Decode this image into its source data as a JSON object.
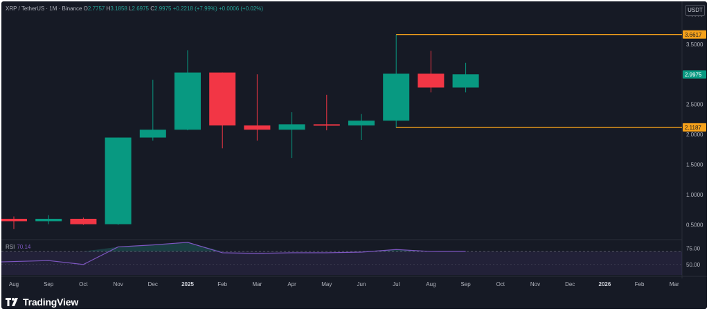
{
  "header": {
    "symbol": "XRP / TetherUS · 1M · Binance",
    "open_key": "O",
    "open": "2.7757",
    "high_key": "H",
    "high": "3.1858",
    "low_key": "L",
    "low": "2.6975",
    "close_key": "C",
    "close": "2.9975",
    "change": "+0.2218 (+7.99%)",
    "change2": "+0.0006 (+0.02%)"
  },
  "currency_button": "USDT",
  "brand": "TradingView",
  "colors": {
    "up": "#089981",
    "down": "#f23645",
    "level": "#f7a21b",
    "rsi": "#7e57c2",
    "background": "#161a25"
  },
  "chart_data": {
    "type": "candlestick",
    "interval": "1M",
    "x_tick_labels": [
      "Aug",
      "Sep",
      "Oct",
      "Nov",
      "Dec",
      "2025",
      "Feb",
      "Mar",
      "Apr",
      "May",
      "Jun",
      "Jul",
      "Aug",
      "Sep",
      "Oct",
      "Nov",
      "Dec",
      "2026",
      "Feb",
      "Mar"
    ],
    "y_ticks": [
      "0.5000",
      "1.0000",
      "1.5000",
      "2.0000",
      "2.5000",
      "3.0000",
      "3.5000",
      "4.0000"
    ],
    "y_tick_values": [
      0.5,
      1.0,
      1.5,
      2.0,
      2.5,
      3.0,
      3.5,
      4.0
    ],
    "ylim": [
      0.3,
      4.05
    ],
    "candles": [
      {
        "month": "Aug",
        "o": 0.6,
        "h": 0.64,
        "l": 0.43,
        "c": 0.56
      },
      {
        "month": "Sep",
        "o": 0.56,
        "h": 0.66,
        "l": 0.51,
        "c": 0.6
      },
      {
        "month": "Oct",
        "o": 0.6,
        "h": 0.62,
        "l": 0.5,
        "c": 0.51
      },
      {
        "month": "Nov",
        "o": 0.51,
        "h": 1.95,
        "l": 0.5,
        "c": 1.95
      },
      {
        "month": "Dec",
        "o": 1.95,
        "h": 2.91,
        "l": 1.9,
        "c": 2.08
      },
      {
        "month": "2025",
        "o": 2.08,
        "h": 3.4,
        "l": 2.07,
        "c": 3.03
      },
      {
        "month": "Feb",
        "o": 3.03,
        "h": 3.03,
        "l": 1.77,
        "c": 2.15
      },
      {
        "month": "Mar",
        "o": 2.15,
        "h": 3.0,
        "l": 1.9,
        "c": 2.08
      },
      {
        "month": "Apr",
        "o": 2.08,
        "h": 2.37,
        "l": 1.61,
        "c": 2.17
      },
      {
        "month": "May",
        "o": 2.17,
        "h": 2.66,
        "l": 2.07,
        "c": 2.15
      },
      {
        "month": "Jun",
        "o": 2.15,
        "h": 2.34,
        "l": 1.91,
        "c": 2.23
      },
      {
        "month": "Jul",
        "o": 2.23,
        "h": 3.66,
        "l": 2.11,
        "c": 3.01
      },
      {
        "month": "Aug",
        "o": 3.01,
        "h": 3.39,
        "l": 2.7,
        "c": 2.78
      },
      {
        "month": "Sep",
        "o": 2.78,
        "h": 3.19,
        "l": 2.7,
        "c": 3.0
      }
    ],
    "horizontal_lines": [
      {
        "value": 3.6617,
        "label": "3.6617",
        "start_index": 11
      },
      {
        "value": 2.1187,
        "label": "2.1187",
        "start_index": 11
      }
    ],
    "current_price": {
      "value": 2.9975,
      "label": "2.9975"
    },
    "rsi": {
      "label": "RSI",
      "value_label": "70.14",
      "y_ticks": [
        "50.00",
        "75.00"
      ],
      "y_tick_values": [
        50,
        75
      ],
      "upper_band": 70,
      "lower_band": 30,
      "ylim": [
        36,
        86
      ],
      "values": [
        54,
        56,
        50,
        77,
        80,
        84,
        68,
        67,
        68,
        68,
        69,
        73,
        70,
        70.14
      ]
    }
  }
}
